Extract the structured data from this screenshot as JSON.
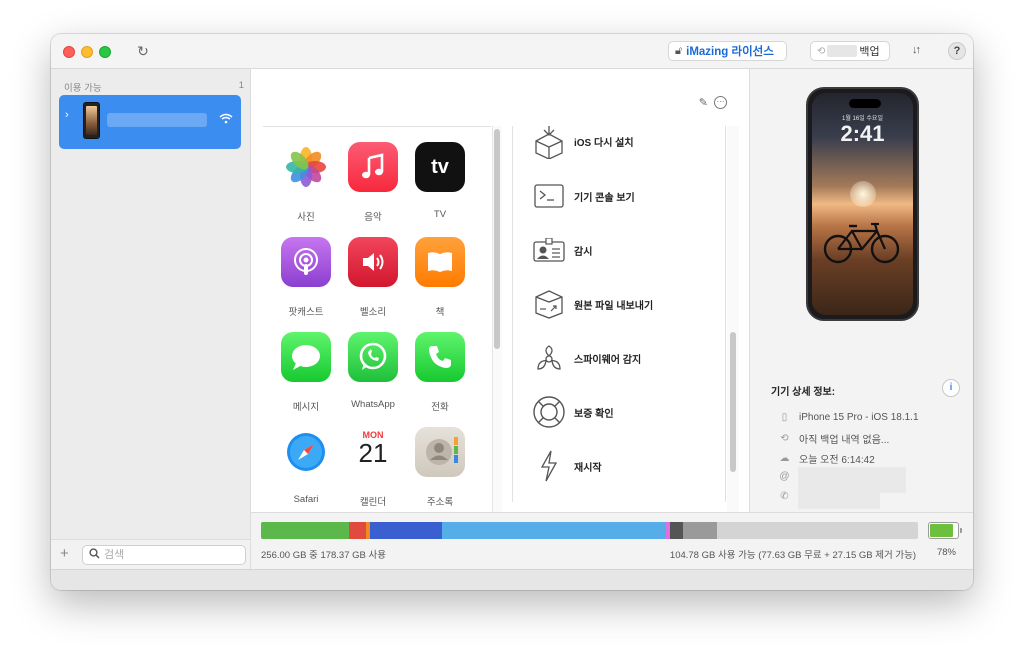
{
  "titlebar": {
    "license_label": "iMazing 라이선스",
    "backup_label": "백업",
    "help_label": "?",
    "transfer_icon": "arrows-icon"
  },
  "sidebar": {
    "header": "이용 가능",
    "count": "1",
    "search_placeholder": "검색",
    "add_label": "+"
  },
  "apps": [
    {
      "label": "사진",
      "icon": "photos-icon"
    },
    {
      "label": "음악",
      "icon": "music-icon"
    },
    {
      "label": "TV",
      "icon": "tv-icon"
    },
    {
      "label": "팟캐스트",
      "icon": "podcasts-icon"
    },
    {
      "label": "벨소리",
      "icon": "ringtones-icon"
    },
    {
      "label": "책",
      "icon": "books-icon"
    },
    {
      "label": "메시지",
      "icon": "messages-icon"
    },
    {
      "label": "WhatsApp",
      "icon": "whatsapp-icon"
    },
    {
      "label": "전화",
      "icon": "phone-icon"
    },
    {
      "label": "Safari",
      "icon": "safari-icon"
    },
    {
      "label": "캘린더",
      "icon": "calendar-icon"
    },
    {
      "label": "주소록",
      "icon": "contacts-icon"
    }
  ],
  "calendar": {
    "month": "MON",
    "day": "21"
  },
  "tv_text": "tv",
  "actions": [
    {
      "label": "iOS 다시 설치",
      "icon": "reinstall-icon"
    },
    {
      "label": "기기 콘솔 보기",
      "icon": "console-icon"
    },
    {
      "label": "감시",
      "icon": "supervision-icon"
    },
    {
      "label": "원본 파일 내보내기",
      "icon": "export-icon"
    },
    {
      "label": "스파이웨어 감지",
      "icon": "spyware-icon"
    },
    {
      "label": "보증 확인",
      "icon": "warranty-icon"
    },
    {
      "label": "재시작",
      "icon": "restart-icon"
    }
  ],
  "phone_preview": {
    "date": "1월 16일 수요일",
    "time": "2:41"
  },
  "details": {
    "title": "기기 상세 정보:",
    "info_label": "i",
    "rows": [
      {
        "text": "iPhone 15 Pro - iOS 18.1.1",
        "icon": "device-icon"
      },
      {
        "text": "아직 백업 내역 없음...",
        "icon": "history-icon"
      },
      {
        "text": "오늘 오전 6:14:42",
        "icon": "cloud-icon"
      },
      {
        "text": "",
        "icon": "at-icon"
      },
      {
        "text": "",
        "icon": "phone-call-icon"
      }
    ]
  },
  "storage": {
    "used_text": "256.00 GB 중 178.37 GB 사용",
    "available_text": "104.78 GB 사용 가능 (77.63 GB 무료 + 27.15 GB 제거 가능)",
    "battery_percent": "78%",
    "battery_level": 0.78,
    "segments": [
      {
        "name": "apps",
        "color": "#5cb84a",
        "fraction": 0.134
      },
      {
        "name": "photos",
        "color": "#e04a3f",
        "fraction": 0.026
      },
      {
        "name": "music",
        "color": "#f08a24",
        "fraction": 0.006
      },
      {
        "name": "media",
        "color": "#3a5fd0",
        "fraction": 0.11
      },
      {
        "name": "documents",
        "color": "#55aee8",
        "fraction": 0.34
      },
      {
        "name": "books",
        "color": "#e070e0",
        "fraction": 0.006
      },
      {
        "name": "system",
        "color": "#555555",
        "fraction": 0.02
      },
      {
        "name": "other",
        "color": "#9a9a9a",
        "fraction": 0.052
      }
    ]
  }
}
